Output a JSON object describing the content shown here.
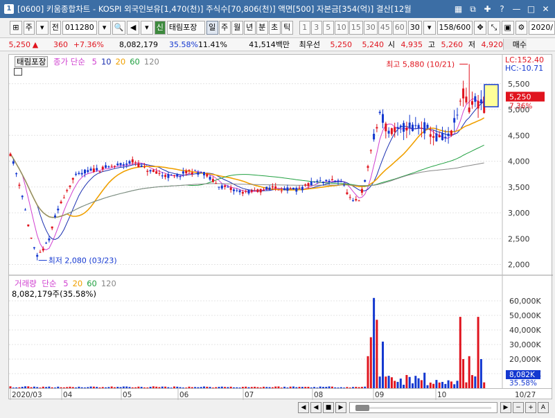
{
  "window": {
    "icon_label": "1",
    "title": "[0600] 키움종합차트 - KOSPI 외국인보유[1,470(천)] 주식수[70,806(천)] 액면[500] 자본금[354(억)] 결산[12월"
  },
  "toolbar": {
    "period_label": "주",
    "prev_label": "전",
    "stock_code": "011280",
    "stock_badge": "신",
    "stock_name": "태림포장",
    "period_tabs": [
      "일",
      "주",
      "월",
      "년",
      "분",
      "초",
      "틱"
    ],
    "interval_buttons": [
      "1",
      "3",
      "5",
      "10",
      "15",
      "30",
      "45",
      "60"
    ],
    "interval_select": "30",
    "count_display": "158/600",
    "date_display": "2020/"
  },
  "quote": {
    "price": "5,250",
    "change": "360",
    "change_pct": "+7.36%",
    "volume": "8,082,179",
    "volume_ratio": "35.58%",
    "turnover_ratio": "11.41%",
    "trade_value": "41,514백만",
    "pref_label": "최우선",
    "ask": "5,250",
    "bid": "5,240",
    "open_label": "시",
    "open": "4,935",
    "high_label": "고",
    "high": "5,260",
    "low_label": "저",
    "low": "4,920",
    "buy_label": "매수"
  },
  "price_panel": {
    "stock_tag": "태림포장",
    "legend_title": "종가 단순",
    "ma_periods": [
      "5",
      "10",
      "20",
      "60",
      "120"
    ],
    "ma_colors": [
      "#d040d0",
      "#1a2fb0",
      "#f0a000",
      "#20a040",
      "#888888"
    ],
    "lc_text": "LC:152.40",
    "hc_text": "HC:-10.71",
    "high_annotation": "최고 5,880 (10/21)",
    "low_annotation": "최저 2,080 (03/23)",
    "current_price_tag": "5,250",
    "current_pct_tag": "7.36%",
    "y_ticks": [
      "5,500",
      "5,000",
      "4,500",
      "4,000",
      "3,500",
      "3,000",
      "2,500",
      "2,000"
    ]
  },
  "volume_panel": {
    "legend_title": "거래량",
    "legend_type": "단순",
    "ma_periods": [
      "5",
      "20",
      "60",
      "120"
    ],
    "volume_text": "8,082,179주(35.58%)",
    "current_vol_tag": "8,082K",
    "current_vol_pct": "35.58%",
    "y_ticks": [
      "60,000K",
      "50,000K",
      "40,000K",
      "30,000K",
      "20,000K",
      "10,000K"
    ]
  },
  "x_axis": {
    "labels": [
      "2020/03",
      "04",
      "05",
      "06",
      "07",
      "08",
      "09",
      "10"
    ],
    "end_label": "10/27"
  },
  "colors": {
    "up": "#e0141e",
    "down": "#1438d0",
    "titlebar": "#3c6ea5",
    "highlight_box": "#ffff99"
  },
  "chart_data": {
    "type": "candlestick",
    "title": "태림포장",
    "ylim": [
      1900,
      5900
    ],
    "series_close_sample": [
      {
        "date": "2020-03-23",
        "low": 2080
      },
      {
        "date": "2020-10-21",
        "high": 5880
      },
      {
        "date": "2020-10-27",
        "close": 5250
      }
    ]
  }
}
